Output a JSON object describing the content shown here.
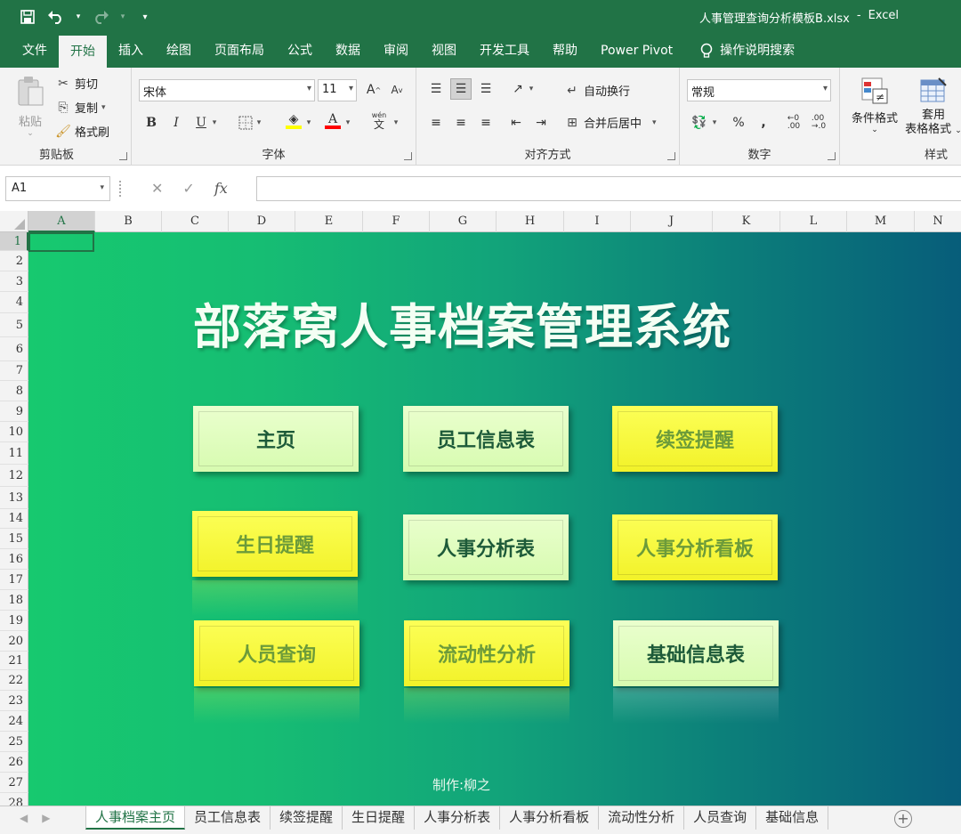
{
  "window": {
    "filename": "人事管理查询分析模板B.xlsx",
    "separator": "-",
    "app": "Excel"
  },
  "ribbon_tabs": [
    "文件",
    "开始",
    "插入",
    "绘图",
    "页面布局",
    "公式",
    "数据",
    "审阅",
    "视图",
    "开发工具",
    "帮助",
    "Power Pivot"
  ],
  "tell_me": "操作说明搜索",
  "clipboard": {
    "paste": "粘贴",
    "cut": "剪切",
    "copy": "复制",
    "format_painter": "格式刷",
    "label": "剪贴板"
  },
  "font": {
    "name": "宋体",
    "size": "11",
    "label": "字体",
    "bold": "B",
    "italic": "I",
    "underline": "U",
    "grow": "A",
    "shrink": "A",
    "color": "A",
    "phonetic": "wén"
  },
  "alignment": {
    "wrap": "自动换行",
    "merge": "合并后居中",
    "label": "对齐方式"
  },
  "number": {
    "format": "常规",
    "percent": "%",
    "comma": ",",
    "label": "数字"
  },
  "styles": {
    "conditional": "条件格式",
    "table_format_1": "套用",
    "table_format_2": "表格格式",
    "label": "样式"
  },
  "formula_bar": {
    "cell_ref": "A1",
    "fx": "fx",
    "value": ""
  },
  "columns": [
    "A",
    "B",
    "C",
    "D",
    "E",
    "F",
    "G",
    "H",
    "I",
    "J",
    "K",
    "L",
    "M",
    "N"
  ],
  "rows": [
    "1",
    "2",
    "3",
    "4",
    "5",
    "6",
    "7",
    "8",
    "9",
    "10",
    "11",
    "12",
    "13",
    "14",
    "15",
    "16",
    "17",
    "18",
    "19",
    "20",
    "21",
    "22",
    "23",
    "24",
    "25",
    "26",
    "27",
    "28"
  ],
  "dashboard": {
    "title": "部落窝人事档案管理系统",
    "buttons": [
      {
        "label": "主页",
        "style": "green"
      },
      {
        "label": "员工信息表",
        "style": "green"
      },
      {
        "label": "续签提醒",
        "style": "yellow"
      },
      {
        "label": "生日提醒",
        "style": "yellow"
      },
      {
        "label": "人事分析表",
        "style": "green"
      },
      {
        "label": "人事分析看板",
        "style": "yellow"
      },
      {
        "label": "人员查询",
        "style": "yellow"
      },
      {
        "label": "流动性分析",
        "style": "yellow"
      },
      {
        "label": "基础信息表",
        "style": "green"
      }
    ],
    "credit": "制作:柳之"
  },
  "sheet_tabs": [
    "人事档案主页",
    "员工信息表",
    "续签提醒",
    "生日提醒",
    "人事分析表",
    "人事分析看板",
    "流动性分析",
    "人员查询",
    "基础信息"
  ],
  "active_sheet": "人事档案主页",
  "colors": {
    "excel_green": "#217346",
    "gradient_start": "#17c96f",
    "gradient_end": "#075d7a",
    "btn_green": "#d7fbb0",
    "btn_yellow": "#f2f229"
  }
}
